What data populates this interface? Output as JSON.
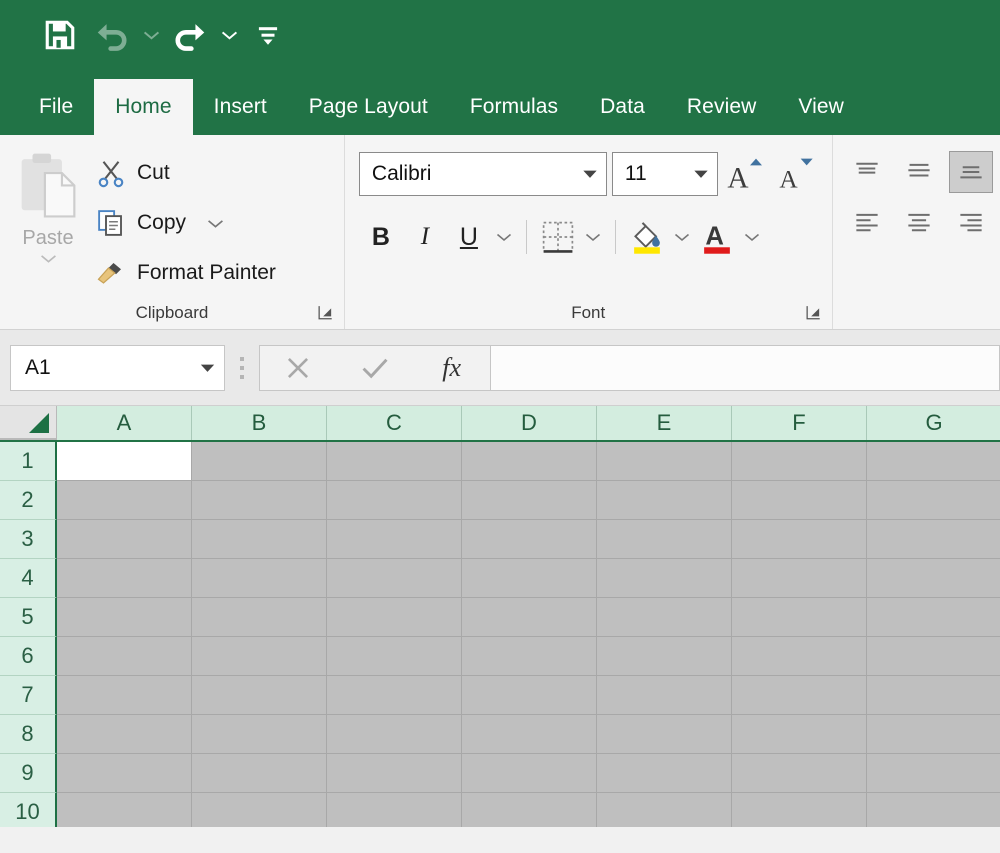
{
  "quick_access": {
    "items": [
      {
        "name": "save",
        "icon": "save-icon",
        "label": "Save",
        "disabled": false
      },
      {
        "name": "undo",
        "icon": "undo-icon",
        "label": "Undo",
        "disabled": true
      },
      {
        "name": "undo-dropdown",
        "icon": "chevron-down-icon",
        "label": "Undo options",
        "disabled": true
      },
      {
        "name": "redo",
        "icon": "redo-icon",
        "label": "Redo",
        "disabled": false
      },
      {
        "name": "redo-dropdown",
        "icon": "chevron-down-icon",
        "label": "Redo options",
        "disabled": false
      },
      {
        "name": "customize-quick-access-toolbar",
        "icon": "customize-icon",
        "label": "Customize Quick Access Toolbar",
        "disabled": false
      }
    ]
  },
  "ribbon": {
    "tabs": [
      {
        "label": "File",
        "active": false
      },
      {
        "label": "Home",
        "active": true
      },
      {
        "label": "Insert",
        "active": false
      },
      {
        "label": "Page Layout",
        "active": false
      },
      {
        "label": "Formulas",
        "active": false
      },
      {
        "label": "Data",
        "active": false
      },
      {
        "label": "Review",
        "active": false
      },
      {
        "label": "View",
        "active": false
      }
    ],
    "groups": {
      "clipboard": {
        "label": "Clipboard",
        "paste": {
          "label": "Paste",
          "disabled": true,
          "has_dropdown": true
        },
        "commands": [
          {
            "label": "Cut",
            "icon": "scissors-icon",
            "has_dropdown": false
          },
          {
            "label": "Copy",
            "icon": "copy-icon",
            "has_dropdown": true
          },
          {
            "label": "Format Painter",
            "icon": "paintbrush-icon",
            "has_dropdown": false
          }
        ],
        "dialog_launcher": "dialog-launcher-icon"
      },
      "font": {
        "label": "Font",
        "font_name": "Calibri",
        "font_size": "11",
        "increase_font_size": "A",
        "decrease_font_size": "A",
        "bold": "B",
        "italic": "I",
        "underline": "U",
        "borders": "borders-icon",
        "fill_color": "fill-color-icon",
        "fill_color_value": "#ffe700",
        "font_color": "A",
        "font_color_value": "#e01b1b",
        "dialog_launcher": "dialog-launcher-icon"
      },
      "alignment": {
        "top_align": "top-align-icon",
        "middle_align": "middle-align-icon",
        "bottom_align": "bottom-align-icon",
        "align_left": "align-left-icon",
        "align_center": "align-center-icon",
        "align_right": "align-right-icon",
        "selected": "bottom-align-icon"
      }
    }
  },
  "formula_bar": {
    "name_box_value": "A1",
    "cancel": "cancel-icon",
    "enter": "enter-icon",
    "insert_function": "fx",
    "formula_value": "",
    "formula_placeholder": ""
  },
  "grid": {
    "columns": [
      "A",
      "B",
      "C",
      "D",
      "E",
      "F",
      "G"
    ],
    "rows": [
      "1",
      "2",
      "3",
      "4",
      "5",
      "6",
      "7",
      "8",
      "9",
      "10"
    ],
    "active_cell": "A1",
    "select_all": "select-all-triangle",
    "cell_values": []
  },
  "colors": {
    "excel_green": "#217346",
    "header_green": "#d3eddf",
    "grid_gray": "#bfbfbf",
    "active_cell": "#ffffff"
  }
}
